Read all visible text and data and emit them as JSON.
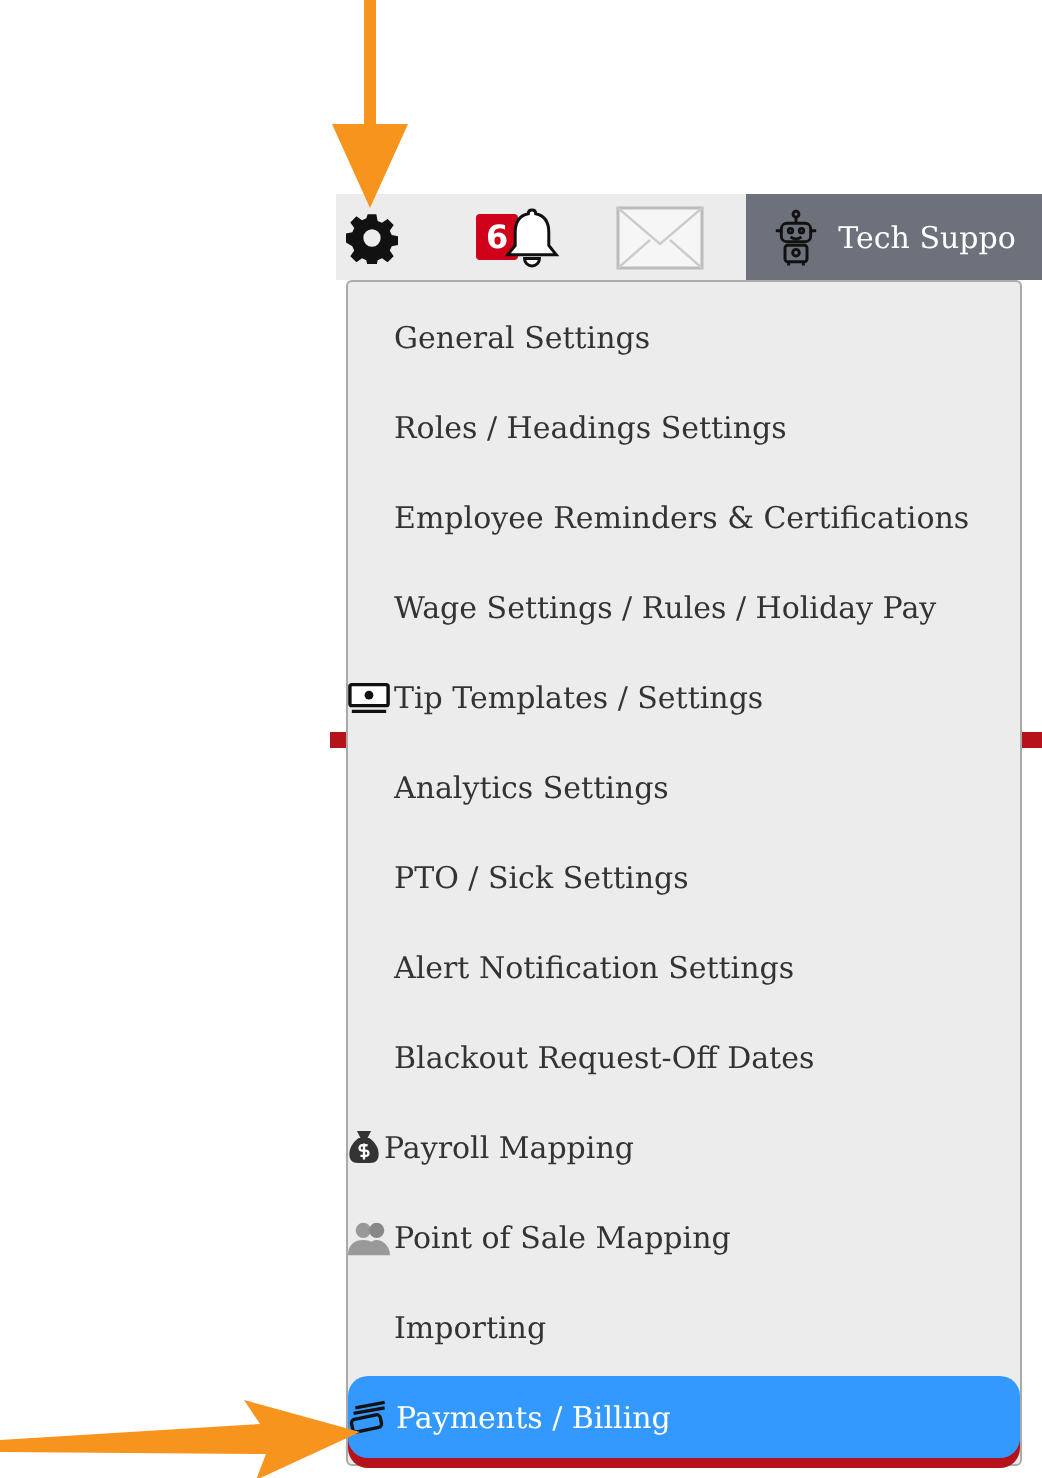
{
  "toolbar": {
    "notification_count": "6",
    "tech_support": "Tech Suppo"
  },
  "menu": [
    {
      "label": "General Settings",
      "kind": "plain",
      "selected": false
    },
    {
      "label": "Roles / Headings Settings",
      "kind": "plain",
      "selected": false
    },
    {
      "label": "Employee Reminders & Certifications",
      "kind": "plain",
      "selected": false
    },
    {
      "label": "Wage Settings / Rules / Holiday Pay",
      "kind": "plain",
      "selected": false
    },
    {
      "label": "Tip Templates / Settings",
      "kind": "cash",
      "selected": false
    },
    {
      "label": "Analytics Settings",
      "kind": "plain",
      "selected": false
    },
    {
      "label": "PTO / Sick Settings",
      "kind": "plain",
      "selected": false
    },
    {
      "label": "Alert Notification Settings",
      "kind": "plain",
      "selected": false
    },
    {
      "label": "Blackout Request-Off Dates",
      "kind": "plain",
      "selected": false
    },
    {
      "label": "Payroll Mapping",
      "kind": "bag",
      "selected": false
    },
    {
      "label": "Point of Sale Mapping",
      "kind": "people",
      "selected": false
    },
    {
      "label": "Importing",
      "kind": "plain",
      "selected": false
    },
    {
      "label": "Payments / Billing",
      "kind": "card",
      "selected": true
    }
  ]
}
